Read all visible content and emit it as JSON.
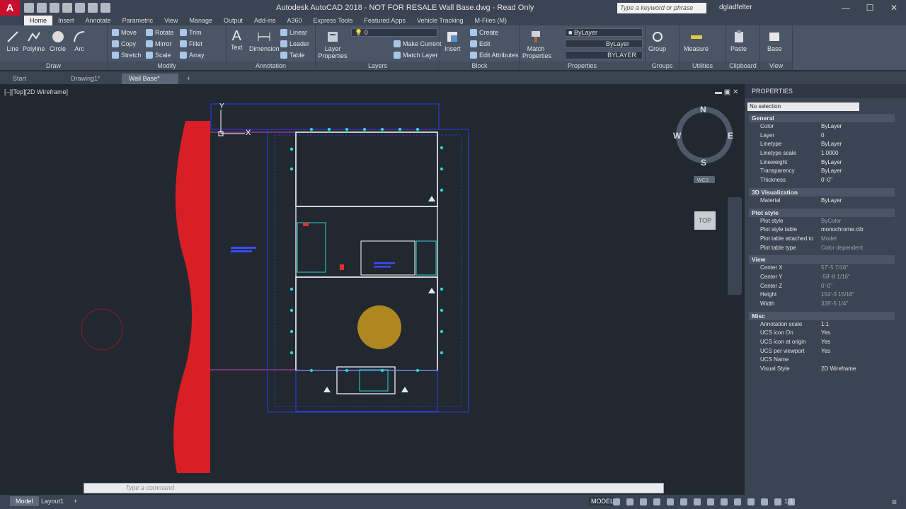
{
  "app": {
    "logo": "A",
    "title": "Autodesk AutoCAD 2018 - NOT FOR RESALE     Wall Base.dwg - Read Only",
    "search_placeholder": "Type a keyword or phrase",
    "user": "dgladfelter"
  },
  "ribbon_tabs": [
    "Home",
    "Insert",
    "Annotate",
    "Parametric",
    "View",
    "Manage",
    "Output",
    "Add-ins",
    "A360",
    "Express Tools",
    "Featured Apps",
    "Vehicle Tracking",
    "M-Files (M)"
  ],
  "draw": {
    "label": "Draw",
    "line": "Line",
    "polyline": "Polyline",
    "circle": "Circle",
    "arc": "Arc"
  },
  "modify": {
    "label": "Modify",
    "move": "Move",
    "rotate": "Rotate",
    "trim": "Trim",
    "copy": "Copy",
    "mirror": "Mirror",
    "fillet": "Fillet",
    "stretch": "Stretch",
    "scale": "Scale",
    "array": "Array"
  },
  "annotation": {
    "label": "Annotation",
    "text": "Text",
    "dimension": "Dimension",
    "linear": "Linear",
    "leader": "Leader",
    "table": "Table"
  },
  "layers": {
    "label": "Layers",
    "layer_properties": "Layer Properties",
    "current_layer": "0",
    "make_current": "Make Current",
    "match_layer": "Match Layer"
  },
  "block": {
    "label": "Block",
    "insert": "Insert",
    "create": "Create",
    "edit": "Edit",
    "edit_attributes": "Edit Attributes"
  },
  "properties_panel": {
    "label": "Properties",
    "match_properties": "Match Properties",
    "color": "ByLayer",
    "lineweight": "ByLayer",
    "linetype": "BYLAYER"
  },
  "groups": {
    "label": "Groups",
    "group": "Group"
  },
  "utilities": {
    "label": "Utilities",
    "measure": "Measure"
  },
  "clipboard": {
    "label": "Clipboard",
    "paste": "Paste"
  },
  "view_panel": {
    "label": "View",
    "base": "Base"
  },
  "doc_tabs": [
    "Start",
    "Drawing1*",
    "Wall Base*"
  ],
  "viewport_label": "[–][Top][2D Wireframe]",
  "viewcube": {
    "n": "N",
    "s": "S",
    "e": "E",
    "w": "W",
    "top": "TOP",
    "wcs": "WCS"
  },
  "ucs": {
    "y": "Y",
    "x": "X"
  },
  "properties": {
    "title": "PROPERTIES",
    "selection": "No selection",
    "sections": [
      {
        "name": "General",
        "rows": [
          {
            "k": "Color",
            "v": "ByLayer"
          },
          {
            "k": "Layer",
            "v": "0"
          },
          {
            "k": "Linetype",
            "v": "ByLayer"
          },
          {
            "k": "Linetype scale",
            "v": "1.0000"
          },
          {
            "k": "Lineweight",
            "v": "ByLayer"
          },
          {
            "k": "Transparency",
            "v": "ByLayer"
          },
          {
            "k": "Thickness",
            "v": "0'-0\""
          }
        ]
      },
      {
        "name": "3D Visualization",
        "rows": [
          {
            "k": "Material",
            "v": "ByLayer"
          }
        ]
      },
      {
        "name": "Plot style",
        "rows": [
          {
            "k": "Plot style",
            "v": "ByColor"
          },
          {
            "k": "Plot style table",
            "v": "monochrome.ctb"
          },
          {
            "k": "Plot table attached to",
            "v": "Model"
          },
          {
            "k": "Plot table type",
            "v": "Color dependent"
          }
        ]
      },
      {
        "name": "View",
        "rows": [
          {
            "k": "Center X",
            "v": "57'-5 7/16\""
          },
          {
            "k": "Center Y",
            "v": "-58'-8 1/16\""
          },
          {
            "k": "Center Z",
            "v": "0'-0\""
          },
          {
            "k": "Height",
            "v": "154'-3 15/16\""
          },
          {
            "k": "Width",
            "v": "328'-5 1/4\""
          }
        ]
      },
      {
        "name": "Misc",
        "rows": [
          {
            "k": "Annotation scale",
            "v": "1:1"
          },
          {
            "k": "UCS icon On",
            "v": "Yes"
          },
          {
            "k": "UCS icon at origin",
            "v": "Yes"
          },
          {
            "k": "UCS per viewport",
            "v": "Yes"
          },
          {
            "k": "UCS Name",
            "v": ""
          },
          {
            "k": "Visual Style",
            "v": "2D Wireframe"
          }
        ]
      }
    ]
  },
  "command_placeholder": "Type a command",
  "status": {
    "model_tab": "Model",
    "layout_tab": "Layout1",
    "model_button": "MODEL",
    "scale": "1:1"
  },
  "colors": {
    "accent_red": "#c8102e",
    "wall_red": "#d81f26",
    "cad_blue": "#2f3cf0",
    "cad_cyan": "#2cd3d8",
    "cursor_highlight": "#c9961f"
  }
}
